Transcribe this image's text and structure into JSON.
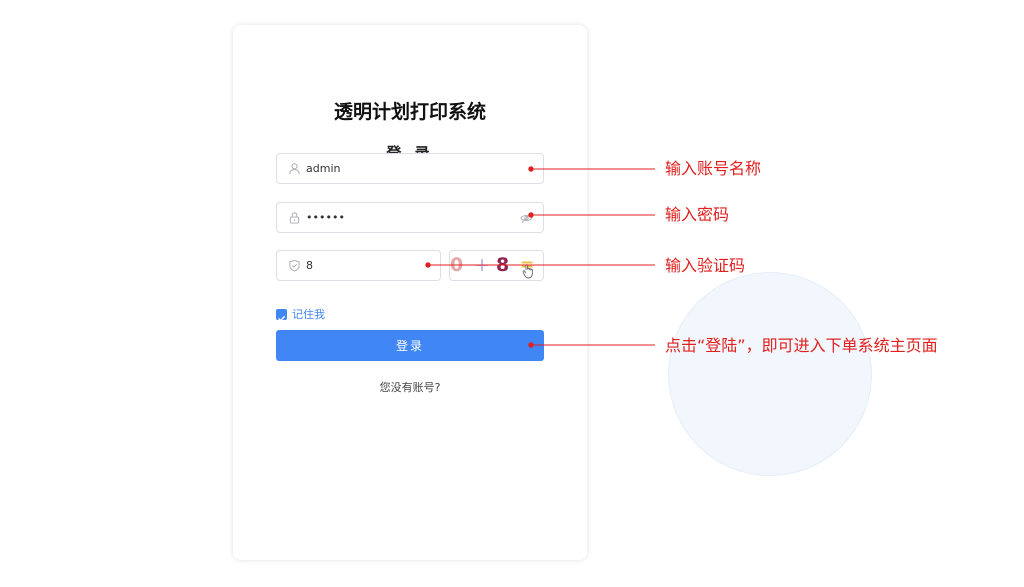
{
  "app": {
    "title": "透明计划打印系统",
    "login_heading": "登 录"
  },
  "form": {
    "username": {
      "value": "admin",
      "icon": "user-icon"
    },
    "password": {
      "value": "••••••",
      "icon": "lock-icon",
      "toggle_icon": "eye-icon"
    },
    "captcha": {
      "value": "8",
      "icon": "shield-icon",
      "image_chars": [
        "0",
        "+",
        "8",
        "="
      ]
    },
    "remember_me": {
      "label": "记住我",
      "checked": true
    },
    "login_button": "登录",
    "register_link": "您没有账号?"
  },
  "annotations": {
    "username": "输入账号名称",
    "password": "输入密码",
    "captcha": "输入验证码",
    "login": "点击“登陆”，即可进入下单系统主页面"
  },
  "colors": {
    "accent": "#4086f5",
    "annotation": "#e0201f"
  }
}
